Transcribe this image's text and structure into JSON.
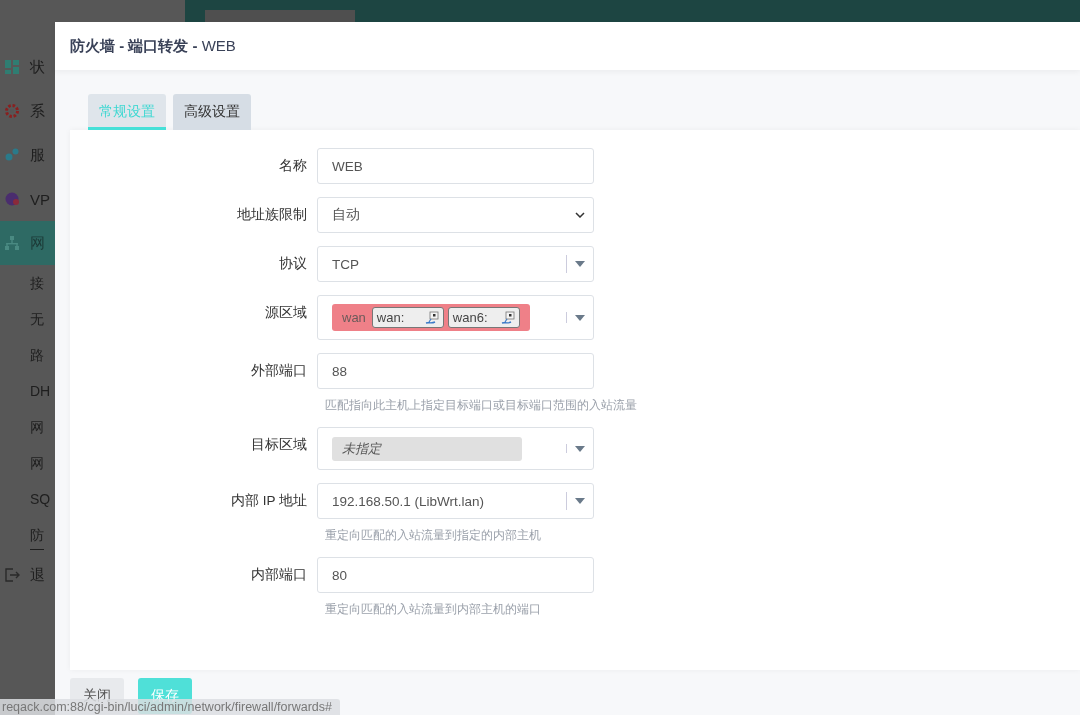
{
  "sidebar": {
    "items": [
      {
        "label": "状",
        "selected": false
      },
      {
        "label": "系",
        "selected": false
      },
      {
        "label": "服",
        "selected": false
      },
      {
        "label": "VP",
        "selected": false
      },
      {
        "label": "网",
        "selected": true,
        "children": [
          {
            "label": "接",
            "selected": false
          },
          {
            "label": "无",
            "selected": false
          },
          {
            "label": "路",
            "selected": false
          },
          {
            "label": "DH",
            "selected": false
          },
          {
            "label": "网",
            "selected": false
          },
          {
            "label": "网",
            "selected": false
          },
          {
            "label": "SQ",
            "selected": false
          },
          {
            "label": "防",
            "selected": true
          }
        ]
      },
      {
        "label": "退",
        "selected": false
      }
    ]
  },
  "dialog": {
    "title": "防火墙 - 端口转发 - ",
    "title_suffix": "WEB",
    "tabs": [
      {
        "label": "常规设置",
        "selected": true
      },
      {
        "label": "高级设置",
        "selected": false
      }
    ],
    "fields": [
      {
        "label": "名称",
        "kind": "text",
        "value": "WEB"
      },
      {
        "label": "地址族限制",
        "kind": "select",
        "value": "自动"
      },
      {
        "label": "协议",
        "kind": "dropdown",
        "value": "TCP"
      },
      {
        "label": "源区域",
        "kind": "zones",
        "zone": {
          "name": "wan",
          "color": "#ef8088",
          "networks": [
            "wan:",
            "wan6:"
          ]
        }
      },
      {
        "label": "外部端口",
        "kind": "text",
        "value": "88",
        "hint": "匹配指向此主机上指定目标端口或目标端口范围的入站流量"
      },
      {
        "label": "目标区域",
        "kind": "zones",
        "zone": {
          "placeholder": "未指定",
          "color": "#e0e0e0"
        }
      },
      {
        "label": "内部 IP 地址",
        "kind": "dropdown",
        "value": "192.168.50.1 (LibWrt.lan)",
        "hint": "重定向匹配的入站流量到指定的内部主机"
      },
      {
        "label": "内部端口",
        "kind": "text",
        "value": "80",
        "hint": "重定向匹配的入站流量到内部主机的端口"
      }
    ],
    "buttons": [
      {
        "label": "关闭",
        "kind": "secondary"
      },
      {
        "label": "保存",
        "kind": "primary"
      }
    ]
  },
  "status_bar": {
    "url": "reqack.com:88/cgi-bin/luci/admin/network/firewall/forwards#"
  }
}
